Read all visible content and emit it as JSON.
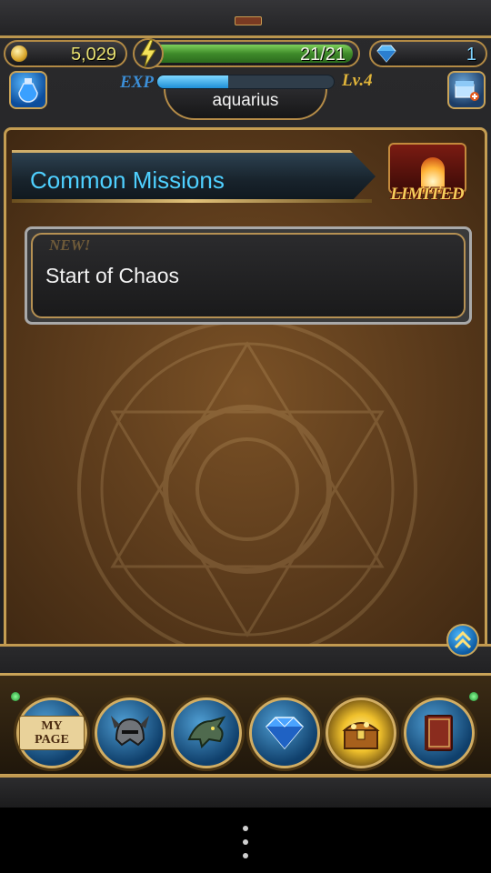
{
  "status": {
    "coins": "5,029",
    "stamina": "21/21",
    "gems": "1",
    "stamina_fraction": 1.0
  },
  "player": {
    "exp_label": "EXP",
    "exp_fraction": 0.4,
    "level_label": "Lv.4",
    "username": "aquarius"
  },
  "missions": {
    "section_title": "Common Missions",
    "limited_label": "LIMITED",
    "items": [
      {
        "tag": "NEW!",
        "title": "Start of Chaos"
      }
    ]
  },
  "nav": {
    "mypage_label": "MY PAGE",
    "items": [
      "my-page",
      "equipment",
      "summon-dragon",
      "crystal",
      "treasure",
      "card-book"
    ]
  },
  "colors": {
    "frame_gold": "#c49d52",
    "board_brown": "#5a3a1b",
    "section_title": "#4fd0ff",
    "stamina_green": "#3e8a2a"
  }
}
